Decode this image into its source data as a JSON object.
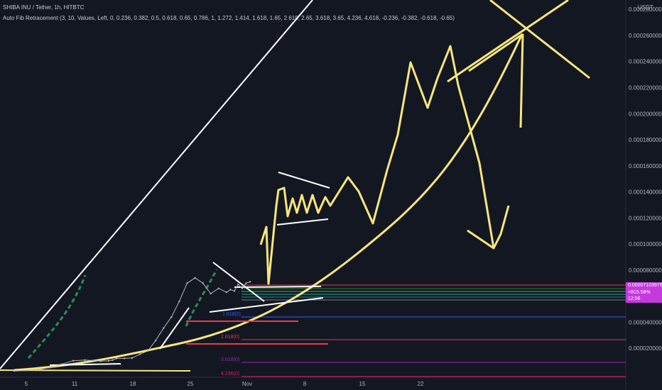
{
  "header": {
    "symbol_line": "SHIBA INU / Tether, 1h, HITBTC",
    "indicator_line": "Auto Fib Retracement (3, 10, Values, Left, 0, 0.236, 0.382, 0.5, 0.618, 0.65, 0.786, 1, 1.272, 1.414, 1.618, 1.65, 2.618, 2.65, 3.618, 3.65, 4.236, 4.618, -0.236, -0.382, -0.618, -0.65)"
  },
  "price_axis": {
    "unit_label": "USDT",
    "last_price": "0.00007103979",
    "change_pct": "+815.58%",
    "countdown": "12:56",
    "box_color": "#c43adc"
  },
  "chart_data": {
    "type": "line",
    "title": "SHIBA INU / Tether, 1h, HITBTC",
    "xlabel": "",
    "ylabel": "USDT",
    "x_ticks": [
      "5",
      "11",
      "18",
      "25",
      "Nov",
      "8",
      "15",
      "22"
    ],
    "y_ticks": [
      2e-05,
      4e-05,
      6e-05,
      8e-05,
      0.0001,
      0.00012,
      0.00014,
      0.00016,
      0.00018,
      0.0002,
      0.00022,
      0.00024,
      0.00026,
      0.00028
    ],
    "ylim": [
      0.0,
      0.000285
    ],
    "grid": false,
    "series": [
      {
        "color": "#b2b5be",
        "x": [
          0,
          3,
          6,
          9,
          12,
          15,
          18,
          20,
          22,
          24,
          25,
          26,
          28,
          30,
          32,
          34,
          36,
          38,
          40,
          42,
          44,
          46,
          48,
          50,
          52,
          54,
          55,
          56,
          57,
          58,
          59,
          60
        ],
        "values": [
          2.6e-06,
          3e-06,
          3.6e-06,
          5.2e-06,
          7.8e-06,
          1.05e-05,
          1.1e-05,
          1.06e-05,
          1.02e-05,
          1.04e-05,
          1.1e-05,
          1.22e-05,
          1.23e-05,
          1.26e-05,
          1.55e-05,
          1.8e-05,
          2.6e-05,
          3.55e-05,
          4.4e-05,
          5.6e-05,
          7e-05,
          7.4e-05,
          7e-05,
          6.2e-05,
          6.6e-05,
          6.3e-05,
          6.5e-05,
          6.4e-05,
          6.9e-05,
          6.6e-05,
          7e-05,
          7.1e-05
        ]
      }
    ],
    "fib_labels": [
      "2.618(0)",
      "1.618(0)",
      "3.618(0)",
      "4.236(0)"
    ],
    "fib_levels": [
      {
        "label": "2.618(0)",
        "value": 2.74e-05,
        "color": "#f23645"
      },
      {
        "label": "1.618(0)",
        "value": 4.64e-05,
        "color": "#2962ff"
      },
      {
        "label": "3.618(0)",
        "value": 1.26e-05,
        "color": "#9c27b0"
      },
      {
        "label": "4.236(0)",
        "value": 6e-06,
        "color": "#e91e63"
      }
    ]
  }
}
